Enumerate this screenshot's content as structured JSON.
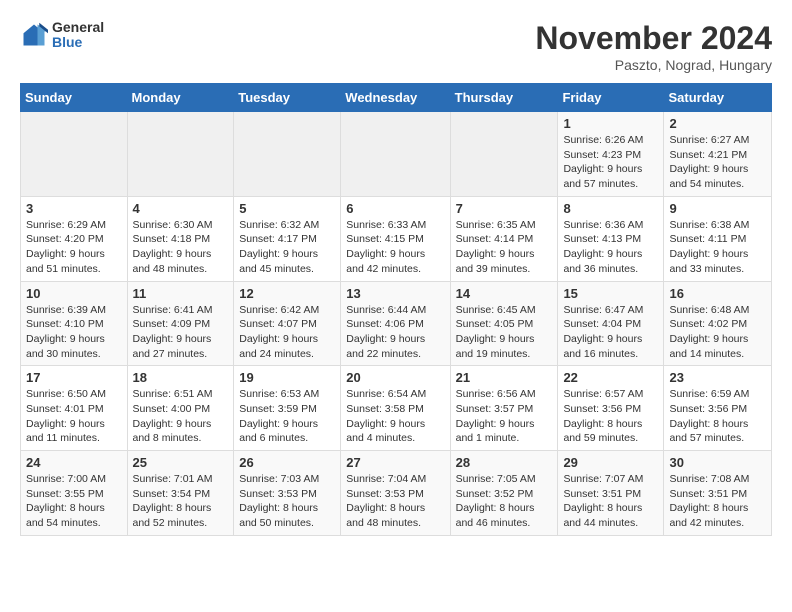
{
  "logo": {
    "general": "General",
    "blue": "Blue"
  },
  "title": "November 2024",
  "location": "Paszto, Nograd, Hungary",
  "headers": [
    "Sunday",
    "Monday",
    "Tuesday",
    "Wednesday",
    "Thursday",
    "Friday",
    "Saturday"
  ],
  "weeks": [
    [
      {
        "day": "",
        "info": ""
      },
      {
        "day": "",
        "info": ""
      },
      {
        "day": "",
        "info": ""
      },
      {
        "day": "",
        "info": ""
      },
      {
        "day": "",
        "info": ""
      },
      {
        "day": "1",
        "info": "Sunrise: 6:26 AM\nSunset: 4:23 PM\nDaylight: 9 hours and 57 minutes."
      },
      {
        "day": "2",
        "info": "Sunrise: 6:27 AM\nSunset: 4:21 PM\nDaylight: 9 hours and 54 minutes."
      }
    ],
    [
      {
        "day": "3",
        "info": "Sunrise: 6:29 AM\nSunset: 4:20 PM\nDaylight: 9 hours and 51 minutes."
      },
      {
        "day": "4",
        "info": "Sunrise: 6:30 AM\nSunset: 4:18 PM\nDaylight: 9 hours and 48 minutes."
      },
      {
        "day": "5",
        "info": "Sunrise: 6:32 AM\nSunset: 4:17 PM\nDaylight: 9 hours and 45 minutes."
      },
      {
        "day": "6",
        "info": "Sunrise: 6:33 AM\nSunset: 4:15 PM\nDaylight: 9 hours and 42 minutes."
      },
      {
        "day": "7",
        "info": "Sunrise: 6:35 AM\nSunset: 4:14 PM\nDaylight: 9 hours and 39 minutes."
      },
      {
        "day": "8",
        "info": "Sunrise: 6:36 AM\nSunset: 4:13 PM\nDaylight: 9 hours and 36 minutes."
      },
      {
        "day": "9",
        "info": "Sunrise: 6:38 AM\nSunset: 4:11 PM\nDaylight: 9 hours and 33 minutes."
      }
    ],
    [
      {
        "day": "10",
        "info": "Sunrise: 6:39 AM\nSunset: 4:10 PM\nDaylight: 9 hours and 30 minutes."
      },
      {
        "day": "11",
        "info": "Sunrise: 6:41 AM\nSunset: 4:09 PM\nDaylight: 9 hours and 27 minutes."
      },
      {
        "day": "12",
        "info": "Sunrise: 6:42 AM\nSunset: 4:07 PM\nDaylight: 9 hours and 24 minutes."
      },
      {
        "day": "13",
        "info": "Sunrise: 6:44 AM\nSunset: 4:06 PM\nDaylight: 9 hours and 22 minutes."
      },
      {
        "day": "14",
        "info": "Sunrise: 6:45 AM\nSunset: 4:05 PM\nDaylight: 9 hours and 19 minutes."
      },
      {
        "day": "15",
        "info": "Sunrise: 6:47 AM\nSunset: 4:04 PM\nDaylight: 9 hours and 16 minutes."
      },
      {
        "day": "16",
        "info": "Sunrise: 6:48 AM\nSunset: 4:02 PM\nDaylight: 9 hours and 14 minutes."
      }
    ],
    [
      {
        "day": "17",
        "info": "Sunrise: 6:50 AM\nSunset: 4:01 PM\nDaylight: 9 hours and 11 minutes."
      },
      {
        "day": "18",
        "info": "Sunrise: 6:51 AM\nSunset: 4:00 PM\nDaylight: 9 hours and 8 minutes."
      },
      {
        "day": "19",
        "info": "Sunrise: 6:53 AM\nSunset: 3:59 PM\nDaylight: 9 hours and 6 minutes."
      },
      {
        "day": "20",
        "info": "Sunrise: 6:54 AM\nSunset: 3:58 PM\nDaylight: 9 hours and 4 minutes."
      },
      {
        "day": "21",
        "info": "Sunrise: 6:56 AM\nSunset: 3:57 PM\nDaylight: 9 hours and 1 minute."
      },
      {
        "day": "22",
        "info": "Sunrise: 6:57 AM\nSunset: 3:56 PM\nDaylight: 8 hours and 59 minutes."
      },
      {
        "day": "23",
        "info": "Sunrise: 6:59 AM\nSunset: 3:56 PM\nDaylight: 8 hours and 57 minutes."
      }
    ],
    [
      {
        "day": "24",
        "info": "Sunrise: 7:00 AM\nSunset: 3:55 PM\nDaylight: 8 hours and 54 minutes."
      },
      {
        "day": "25",
        "info": "Sunrise: 7:01 AM\nSunset: 3:54 PM\nDaylight: 8 hours and 52 minutes."
      },
      {
        "day": "26",
        "info": "Sunrise: 7:03 AM\nSunset: 3:53 PM\nDaylight: 8 hours and 50 minutes."
      },
      {
        "day": "27",
        "info": "Sunrise: 7:04 AM\nSunset: 3:53 PM\nDaylight: 8 hours and 48 minutes."
      },
      {
        "day": "28",
        "info": "Sunrise: 7:05 AM\nSunset: 3:52 PM\nDaylight: 8 hours and 46 minutes."
      },
      {
        "day": "29",
        "info": "Sunrise: 7:07 AM\nSunset: 3:51 PM\nDaylight: 8 hours and 44 minutes."
      },
      {
        "day": "30",
        "info": "Sunrise: 7:08 AM\nSunset: 3:51 PM\nDaylight: 8 hours and 42 minutes."
      }
    ]
  ]
}
